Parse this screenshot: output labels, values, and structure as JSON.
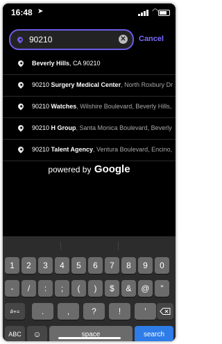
{
  "status_bar": {
    "time": "16:48",
    "location_icon": "location-arrow-icon",
    "signal_icon": "signal-icon",
    "wifi_icon": "wifi-icon",
    "battery_icon": "battery-icon"
  },
  "search": {
    "value": "90210",
    "placeholder": "",
    "cancel_label": "Cancel",
    "accent_color": "#6d5ce8"
  },
  "results": [
    {
      "bold": "Beverly Hills",
      "rest": ", CA 90210"
    },
    {
      "prefix": "90210 ",
      "bold": "Surgery Medical Center",
      "rest": ", North Roxbury Dr"
    },
    {
      "prefix": "90210 ",
      "bold": "Watches",
      "rest": ", Wilshire Boulevard, Beverly Hills,"
    },
    {
      "prefix": "90210 ",
      "bold": "H Group",
      "rest": ", Santa Monica Boulevard, Beverly"
    },
    {
      "prefix": "90210 ",
      "bold": "Talent Agency",
      "rest": ", Ventura Boulevard, Encino,"
    }
  ],
  "attribution": {
    "powered_by": "powered by",
    "brand": "Google"
  },
  "keyboard": {
    "row1": [
      "1",
      "2",
      "3",
      "4",
      "5",
      "6",
      "7",
      "8",
      "9",
      "0"
    ],
    "row2": [
      "-",
      "/",
      ":",
      ";",
      "(",
      ")",
      "$",
      "&",
      "@",
      "\""
    ],
    "row3_switch": "#+=",
    "row3": [
      ".",
      ",",
      "?",
      "!",
      "'"
    ],
    "delete_icon": "delete-icon",
    "abc": "ABC",
    "emoji_icon": "emoji-icon",
    "space": "space",
    "search": "search",
    "search_color": "#2e7ce8"
  }
}
